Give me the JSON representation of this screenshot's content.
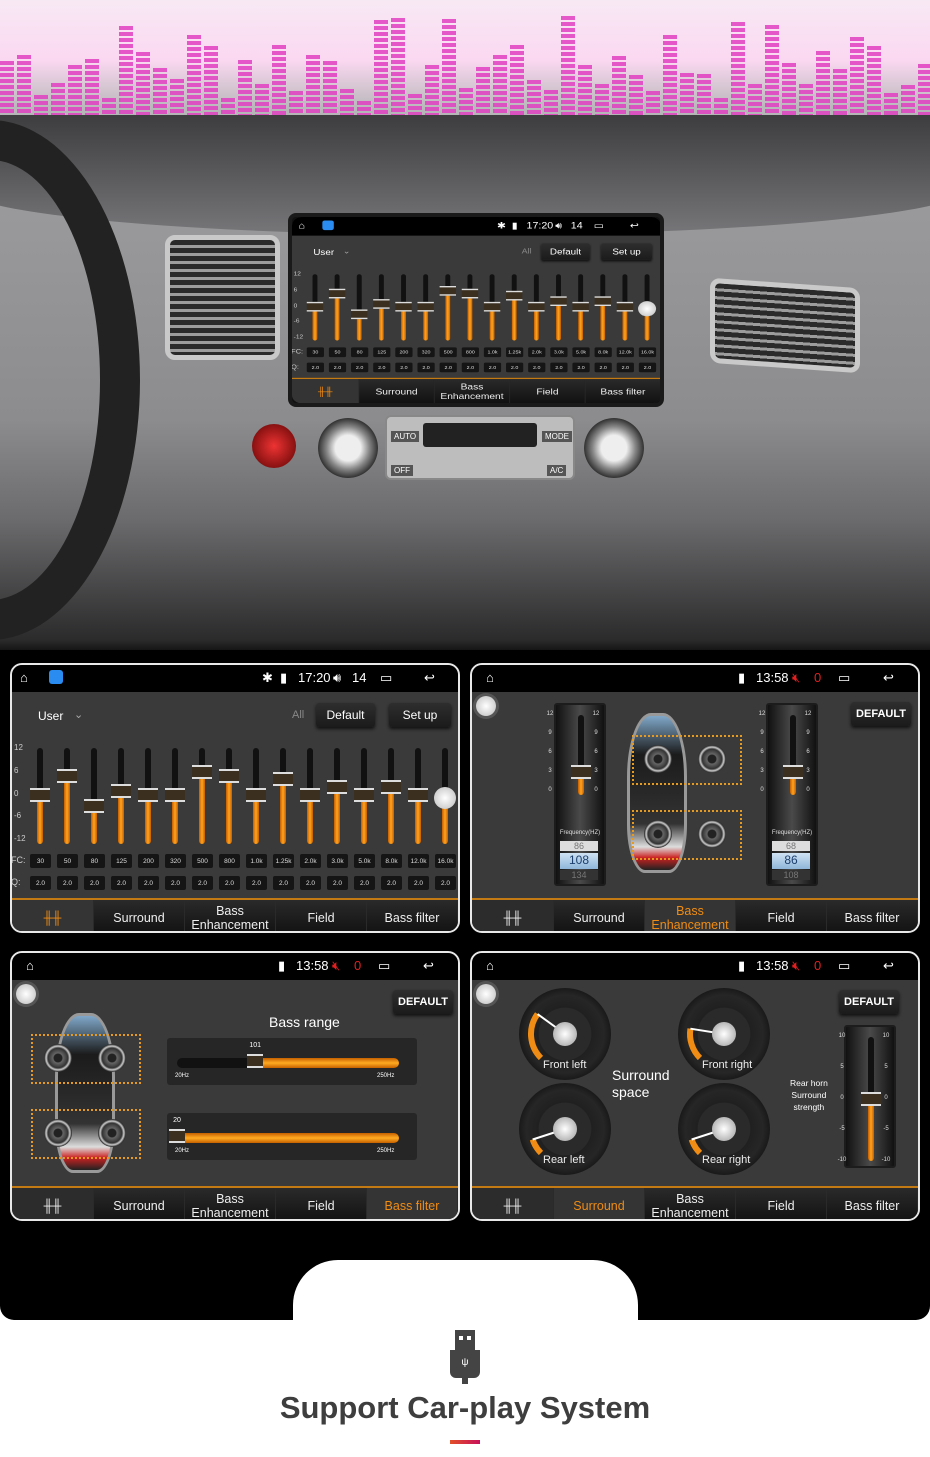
{
  "dashboard": {
    "hvac": {
      "auto": "AUTO",
      "mode": "MODE",
      "off": "OFF",
      "ac": "A/C"
    }
  },
  "colors": {
    "accent": "#f08c13",
    "panel_bg": "#3a3a3a",
    "status_bar": "#000000",
    "mute_red": "#e02020"
  },
  "tabs": {
    "eq_icon": "equalizer-icon",
    "surround": "Surround",
    "bass_enh_1": "Bass",
    "bass_enh_2": "Enhancement",
    "field": "Field",
    "bass_filter": "Bass filter"
  },
  "eq_panel": {
    "status": {
      "time": "17:20",
      "volume": "14",
      "icons": [
        "home-icon",
        "app-icon",
        "bluetooth-icon",
        "sim-icon",
        "volume-icon",
        "recent-apps-icon",
        "back-icon"
      ]
    },
    "preset": "User",
    "all": "All",
    "default": "Default",
    "setup": "Set up",
    "y_ticks": [
      "12",
      "6",
      "0",
      "-6",
      "-12"
    ],
    "fc_label": "FC:",
    "q_label": "Q:",
    "bands": [
      {
        "fc": "30",
        "q": "2.0",
        "gain": 0
      },
      {
        "fc": "50",
        "q": "2.0",
        "gain": 5
      },
      {
        "fc": "80",
        "q": "2.0",
        "gain": -3
      },
      {
        "fc": "125",
        "q": "2.0",
        "gain": 1
      },
      {
        "fc": "200",
        "q": "2.0",
        "gain": 0
      },
      {
        "fc": "320",
        "q": "2.0",
        "gain": 0
      },
      {
        "fc": "500",
        "q": "2.0",
        "gain": 6
      },
      {
        "fc": "800",
        "q": "2.0",
        "gain": 5
      },
      {
        "fc": "1.0k",
        "q": "2.0",
        "gain": 0
      },
      {
        "fc": "1.25k",
        "q": "2.0",
        "gain": 4
      },
      {
        "fc": "2.0k",
        "q": "2.0",
        "gain": 0
      },
      {
        "fc": "3.0k",
        "q": "2.0",
        "gain": 2
      },
      {
        "fc": "5.0k",
        "q": "2.0",
        "gain": 0
      },
      {
        "fc": "8.0k",
        "q": "2.0",
        "gain": 2
      },
      {
        "fc": "12.0k",
        "q": "2.0",
        "gain": 0
      },
      {
        "fc": "16.0k",
        "q": "2.0",
        "gain": -1
      }
    ]
  },
  "status_muted": {
    "time": "13:58",
    "volume": "0"
  },
  "bass_enh_panel": {
    "default": "DEFAULT",
    "freq_label": "Frequency(HZ)",
    "left": {
      "ticks": [
        "12",
        "9",
        "6",
        "3",
        "0"
      ],
      "level": 3,
      "prev": "86",
      "value": "108",
      "next": "134"
    },
    "right": {
      "ticks": [
        "12",
        "9",
        "6",
        "3",
        "0"
      ],
      "level": 3,
      "prev": "68",
      "value": "86",
      "next": "108"
    }
  },
  "bass_filter_panel": {
    "default": "DEFAULT",
    "title": "Bass range",
    "sliders": [
      {
        "value": "101",
        "min": "20Hz",
        "max": "250Hz",
        "num": 101
      },
      {
        "value": "20",
        "min": "20Hz",
        "max": "250Hz",
        "num": 20
      }
    ]
  },
  "surround_panel": {
    "default": "DEFAULT",
    "space_label_1": "Surround",
    "space_label_2": "space",
    "gauges": [
      {
        "label": "Front left",
        "value": 30
      },
      {
        "label": "Front right",
        "value": 20
      },
      {
        "label": "Rear left",
        "value": 10
      },
      {
        "label": "Rear right",
        "value": 10
      }
    ],
    "horn_1": "Rear horn",
    "horn_2": "Surround",
    "horn_3": "strength",
    "strength_ticks": [
      "10",
      "5",
      "0",
      "-5",
      "-10"
    ],
    "strength": 0
  },
  "footer": {
    "icon": "usb-icon",
    "title": "Support Car-play System"
  }
}
